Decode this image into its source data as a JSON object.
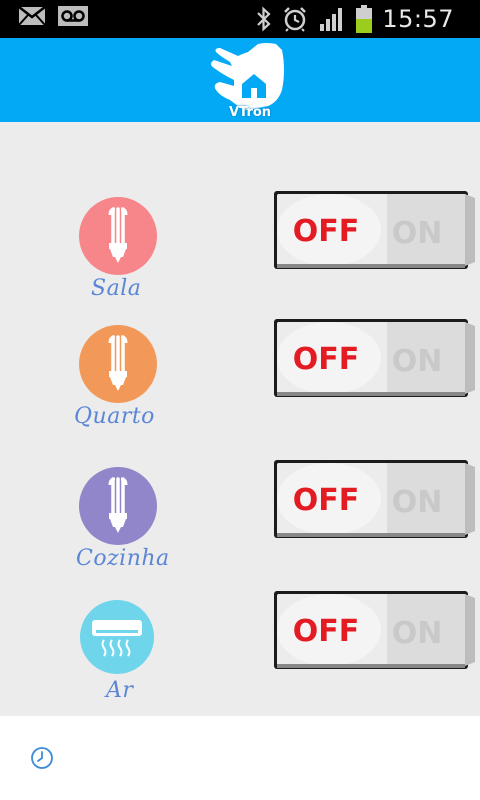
{
  "status_bar": {
    "time": "15:57",
    "icons": [
      "mail-icon",
      "voicemail-icon",
      "bluetooth-icon",
      "alarm-icon",
      "signal-icon",
      "battery-icon"
    ]
  },
  "header": {
    "logo_text": "VTron",
    "background_color": "#03a9f4"
  },
  "devices": [
    {
      "label": "Sala",
      "icon": "lightbulb-icon",
      "icon_color": "#f7868a",
      "switch": {
        "off_label": "OFF",
        "on_label": "ON",
        "state": "off"
      }
    },
    {
      "label": "Quarto",
      "icon": "lightbulb-icon",
      "icon_color": "#f2995a",
      "switch": {
        "off_label": "OFF",
        "on_label": "ON",
        "state": "off"
      }
    },
    {
      "label": "Cozinha",
      "icon": "lightbulb-icon",
      "icon_color": "#9186c9",
      "switch": {
        "off_label": "OFF",
        "on_label": "ON",
        "state": "off"
      }
    },
    {
      "label": "Ar",
      "icon": "air-conditioner-icon",
      "icon_color": "#6fd5ea",
      "switch": {
        "off_label": "OFF",
        "on_label": "ON",
        "state": "off"
      }
    }
  ],
  "bottom_bar": {
    "icon": "clock-icon"
  }
}
